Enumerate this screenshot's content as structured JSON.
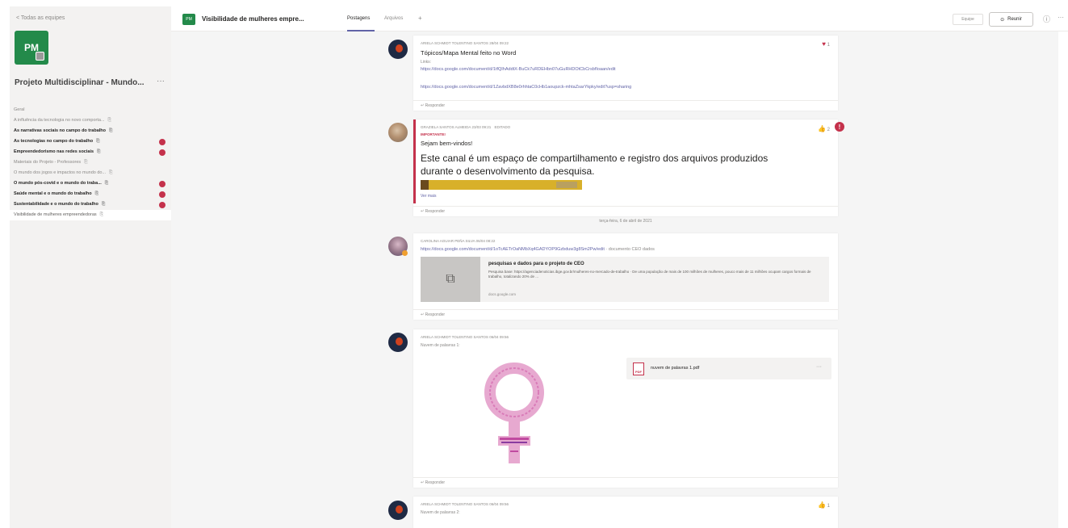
{
  "left_panel": {
    "back": "< Todas as equipes",
    "team_avatar": "PM",
    "team_name": "Projeto Multidisciplinar - Mundo...",
    "team_more": "···",
    "channels": [
      {
        "label": "Geral",
        "bold": false,
        "alert": false,
        "icon": false
      },
      {
        "label": "A influência da tecnologia no novo comporta...",
        "bold": false,
        "alert": false,
        "icon": true
      },
      {
        "label": "As narrativas sociais no campo do trabalho",
        "bold": true,
        "alert": false,
        "icon": true
      },
      {
        "label": "As tecnologias no campo do trabalho",
        "bold": true,
        "alert": true,
        "icon": true
      },
      {
        "label": "Empreendedorismo nas redes sociais",
        "bold": true,
        "alert": true,
        "icon": true
      },
      {
        "label": "Materiais do Projeto - Professores",
        "bold": false,
        "alert": false,
        "icon": true
      },
      {
        "label": "O mundo dos jogos e impactos no mundo do...",
        "bold": false,
        "alert": false,
        "icon": true
      },
      {
        "label": "O mundo pós-covid e o mundo do traba...",
        "bold": true,
        "alert": true,
        "icon": true
      },
      {
        "label": "Saúde mental e o mundo do trabalho",
        "bold": true,
        "alert": true,
        "icon": true
      },
      {
        "label": "Sustentabilidade e o mundo do trabalho",
        "bold": true,
        "alert": true,
        "icon": true
      },
      {
        "label": "Visibilidade de mulheres empreendedoras",
        "bold": false,
        "alert": false,
        "icon": true,
        "selected": true
      }
    ]
  },
  "header": {
    "avatar": "PM",
    "title": "Visibilidade de mulheres empre...",
    "tabs": [
      "Postagens",
      "Arquivos"
    ],
    "add": "+",
    "team_btn": "Equipe",
    "meet_btn": "Reunir",
    "info": "ⓘ",
    "more": "···"
  },
  "posts": {
    "p1": {
      "meta": "Ariela Schmidt Tolentino Santos  28/04 09:22",
      "title": "Tópicos/Mapa Mental feito no Word",
      "sub": "Links:",
      "link1": "https://docs.google.com/document/d/1tfQIhAddtX-BuCk7uRDEHbn07uGuRHDOtCbCrsbfIoaan/edit",
      "link2": "https://docs.google.com/document/d/1ZavbdXB8e0rhhtaC0cHb1aoupzck-mhtaZsarYkpky/edit?usp=sharing",
      "reaction": "1",
      "reply": "↵ Responder"
    },
    "p2": {
      "meta": "Graziela Santos Almeida  23/03 09:21",
      "edited": "Editado",
      "important": "IMPORTANTE!",
      "hello": "Sejam bem-vindos!",
      "line1": "Este canal é um espaço de compartilhamento e registro dos arquivos produzidos",
      "line2": "durante o desenvolvimento da pesquisa.",
      "more": "Ver mais",
      "reaction": "2",
      "alert": "!",
      "reply": "↵ Responder"
    },
    "date_separator": "terça-feira, 6 de abril de 2021",
    "p3": {
      "meta": "Carolina Aguiar Peña Silva  06/04 08:22",
      "link": "https://docs.google.com/document/d/1oTcAETrOaNMbXq4GADYOP9Gzbduw3g8Sm2Pw/edit",
      "link_tail": "  ·  documento CEO dados",
      "card_title": "pesquisas e dados para o projeto de CEO",
      "card_desc": "Pesquisa base: https://agenciadenoticias.ibge.gov.br/mulheres-no-mercado-de-trabalho · De uma população de mais de 100 milhões de mulheres, pouco mais de 11 milhões ocupam cargos formais de trabalho, totalizando 20% de ...",
      "card_site": "docs.google.com",
      "card_icon": "⧉",
      "reply": "↵ Responder"
    },
    "p4": {
      "meta": "Ariela Schmidt Tolentino Santos  06/04 09:56",
      "text": "Nuvem de palavras 1:",
      "file_ext": "PDF",
      "file_name": "nuvem de palavras 1.pdf",
      "file_more": "···",
      "reply": "↵ Responder"
    },
    "p5": {
      "meta": "Ariela Schmidt Tolentino Santos  06/04 09:56",
      "text": "Nuvem de palavras 2:",
      "reaction": "1"
    }
  },
  "colors": {
    "accent": "#6264a7",
    "team_green": "#238a4a",
    "alert_red": "#c4314b",
    "like_yellow": "#f8c033"
  }
}
